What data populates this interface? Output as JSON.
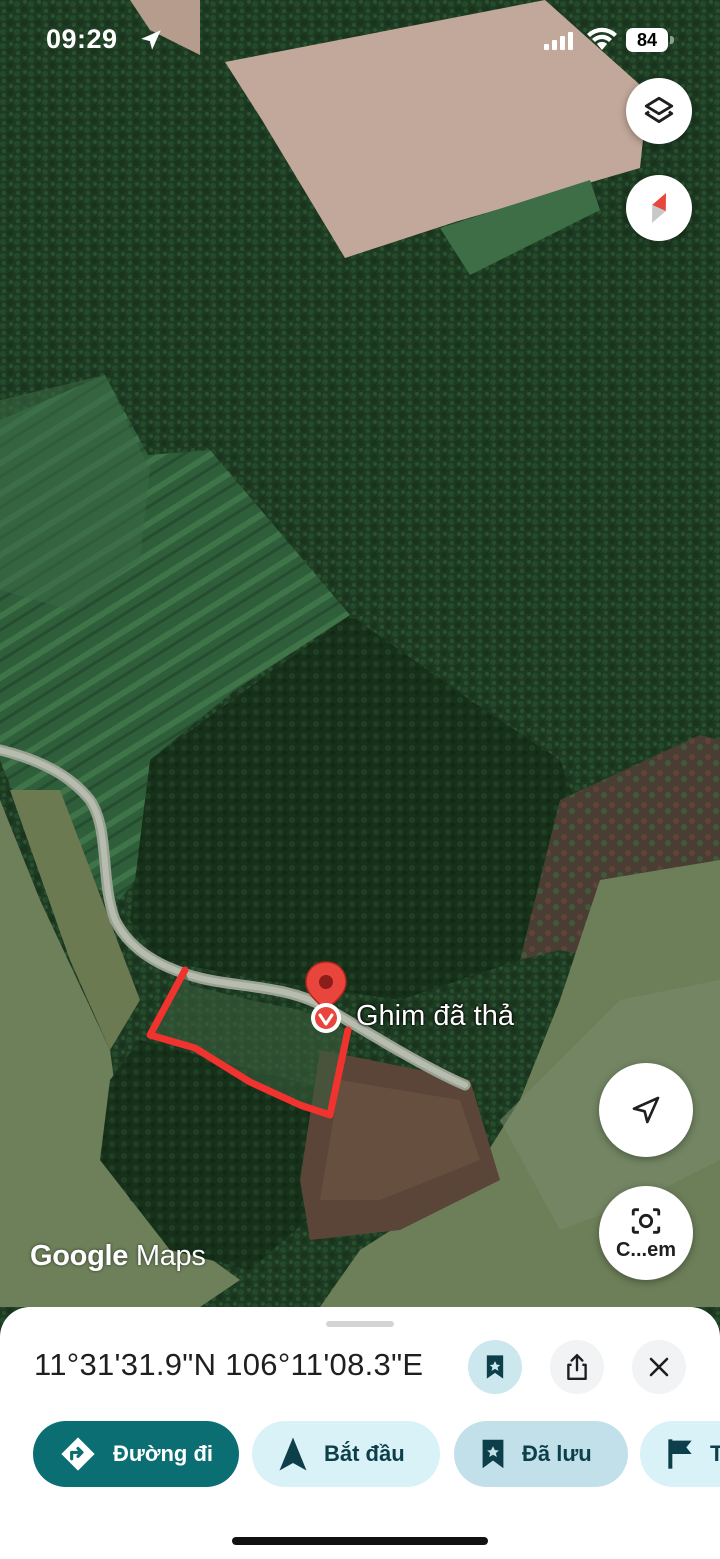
{
  "status_bar": {
    "time": "09:29",
    "battery": "84"
  },
  "map": {
    "watermark_google": "Google",
    "watermark_maps": "Maps",
    "pin_label": "Ghim đã thả",
    "boundary_color": "#f0332e"
  },
  "buttons": {
    "layers_icon": "layers-icon",
    "compass_icon": "compass-icon",
    "locate_icon": "navigation-arrow-icon",
    "lens_label": "C...em"
  },
  "sheet": {
    "coordinates": "11°31'31.9\"N 106°11'08.3\"E",
    "actions": {
      "directions": "Đường đi",
      "start": "Bắt đầu",
      "saved": "Đã lưu",
      "label_partial": "T"
    }
  },
  "colors": {
    "primary_chip": "#0b6e73",
    "secondary_chip": "#d9f2f7",
    "pin_red": "#e8453c"
  }
}
